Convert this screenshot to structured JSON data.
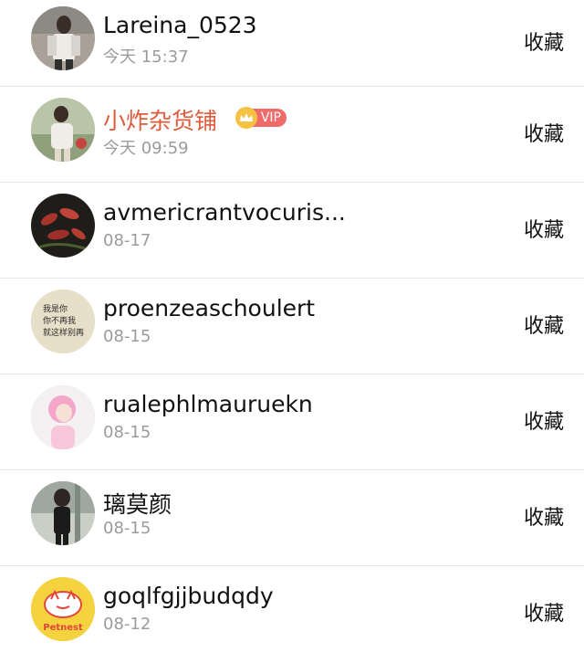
{
  "items": [
    {
      "name": "Lareina_0523",
      "time": "今天 15:37",
      "action": "收藏",
      "vip": false
    },
    {
      "name": "小炸杂货铺",
      "time": "今天 09:59",
      "action": "收藏",
      "vip": true,
      "vip_label": "VIP",
      "name_color": "#e05a3c"
    },
    {
      "name": "avmericrantvocuris...",
      "time": "08-17",
      "action": "收藏",
      "vip": false
    },
    {
      "name": "proenzeaschoulert",
      "time": "08-15",
      "action": "收藏",
      "vip": false,
      "avatar_text": [
        "我是你",
        "你不再我",
        "就这样别再"
      ]
    },
    {
      "name": "rualephlmauruekn",
      "time": "08-15",
      "action": "收藏",
      "vip": false
    },
    {
      "name": "璃莫颜",
      "time": "08-15",
      "action": "收藏",
      "vip": false
    },
    {
      "name": "goqlfgjjbudqdy",
      "time": "08-12",
      "action": "收藏",
      "vip": false,
      "avatar_text": [
        "Petnest"
      ]
    }
  ]
}
